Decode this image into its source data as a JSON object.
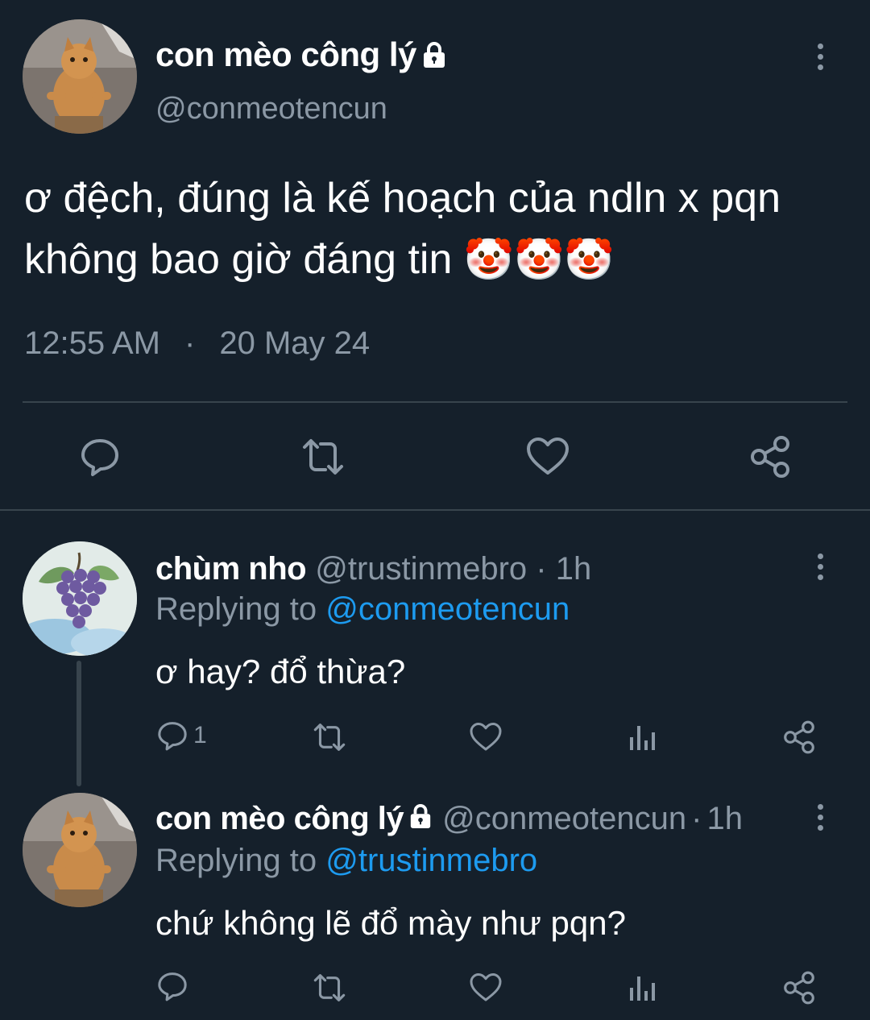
{
  "main_tweet": {
    "display_name": "con mèo công lý",
    "handle": "@conmeotencun",
    "text_line1": "ơ đệch, đúng là kế hoạch của ndln x pqn",
    "text_line2": "không bao giờ đáng tin",
    "emojis": "🤡🤡🤡",
    "time": "12:55 AM",
    "separator": "·",
    "date": "20 May 24"
  },
  "reply1": {
    "display_name": "chùm nho",
    "handle": "@trustinmebro",
    "time_sep": "·",
    "time": "1h",
    "replying_label": "Replying to",
    "replying_to": "@conmeotencun",
    "text": "ơ hay? đổ thừa?",
    "reply_count": "1"
  },
  "reply2": {
    "display_name": "con mèo công lý",
    "handle": "@conmeotencun",
    "time_sep": "·",
    "time": "1h",
    "replying_label": "Replying to",
    "replying_to": "@trustinmebro",
    "text": "chứ không lẽ đổ mày như pqn?"
  },
  "icons": {
    "reply": "reply-icon",
    "retweet": "retweet-icon",
    "like": "heart-icon",
    "share": "share-icon",
    "views": "views-icon",
    "more": "more-icon",
    "lock": "lock-icon"
  },
  "colors": {
    "background": "#15202b",
    "text": "#ffffff",
    "muted": "#8b98a5",
    "link": "#1d9bf0",
    "divider": "#38444d"
  }
}
